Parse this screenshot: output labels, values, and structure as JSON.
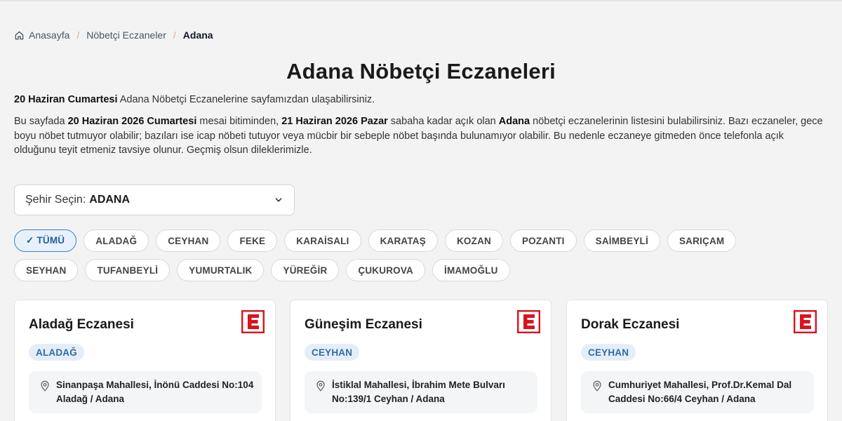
{
  "breadcrumb": {
    "home": "Anasayfa",
    "section": "Nöbetçi Eczaneler",
    "current": "Adana",
    "separator": "/"
  },
  "page": {
    "title": "Adana Nöbetçi Eczaneleri",
    "intro_date": "20 Haziran Cumartesi",
    "intro_rest": " Adana Nöbetçi Eczanelerine sayfamızdan ulaşabilirsiniz.",
    "p2_a": "Bu sayfada ",
    "p2_b": "20 Haziran 2026 Cumartesi",
    "p2_c": " mesai bitiminden, ",
    "p2_d": "21 Haziran 2026 Pazar",
    "p2_e": " sabaha kadar açık olan ",
    "p2_f": "Adana",
    "p2_g": " nöbetçi eczanelerinin listesini bulabilirsiniz. Bazı eczaneler, gece boyu nöbet tutmuyor olabilir; bazıları ise icap nöbeti tutuyor veya mücbir bir sebeple nöbet başında bulunamıyor olabilir. Bu nedenle eczaneye gitmeden önce telefonla açık olduğunu teyit etmeniz tavsiye olunur. Geçmiş olsun dileklerimizle."
  },
  "city_select": {
    "label": "Şehir Seçin:",
    "value": "ADANA"
  },
  "districts": {
    "all": "✓ TÜMÜ",
    "items": [
      "ALADAĞ",
      "CEYHAN",
      "FEKE",
      "KARAİSALI",
      "KARATAŞ",
      "KOZAN",
      "POZANTI",
      "SAİMBEYLİ",
      "SARIÇAM",
      "SEYHAN",
      "TUFANBEYLİ",
      "YUMURTALIK",
      "YÜREĞİR",
      "ÇUKUROVA",
      "İMAMOĞLU"
    ]
  },
  "pharmacies": [
    {
      "name": "Aladağ Eczanesi",
      "district": "ALADAĞ",
      "address": "Sinanpaşa Mahallesi, İnönü Caddesi No:104 Aladağ / Adana"
    },
    {
      "name": "Güneşim Eczanesi",
      "district": "CEYHAN",
      "address": "İstiklal Mahallesi, İbrahim Mete Bulvarı No:139/1 Ceyhan / Adana"
    },
    {
      "name": "Dorak Eczanesi",
      "district": "CEYHAN",
      "address": "Cumhuriyet Mahallesi, Prof.Dr.Kemal Dal Caddesi No:66/4 Ceyhan / Adana"
    }
  ],
  "icons": {
    "home": "home-icon",
    "chevron": "chevron-down-icon",
    "pin": "map-pin-icon",
    "logo": "eczane-e-logo"
  },
  "colors": {
    "accent": "#3b82c4",
    "logo_red": "#d7141f",
    "badge_bg": "#e5eef8",
    "badge_text": "#2f6ca8"
  }
}
